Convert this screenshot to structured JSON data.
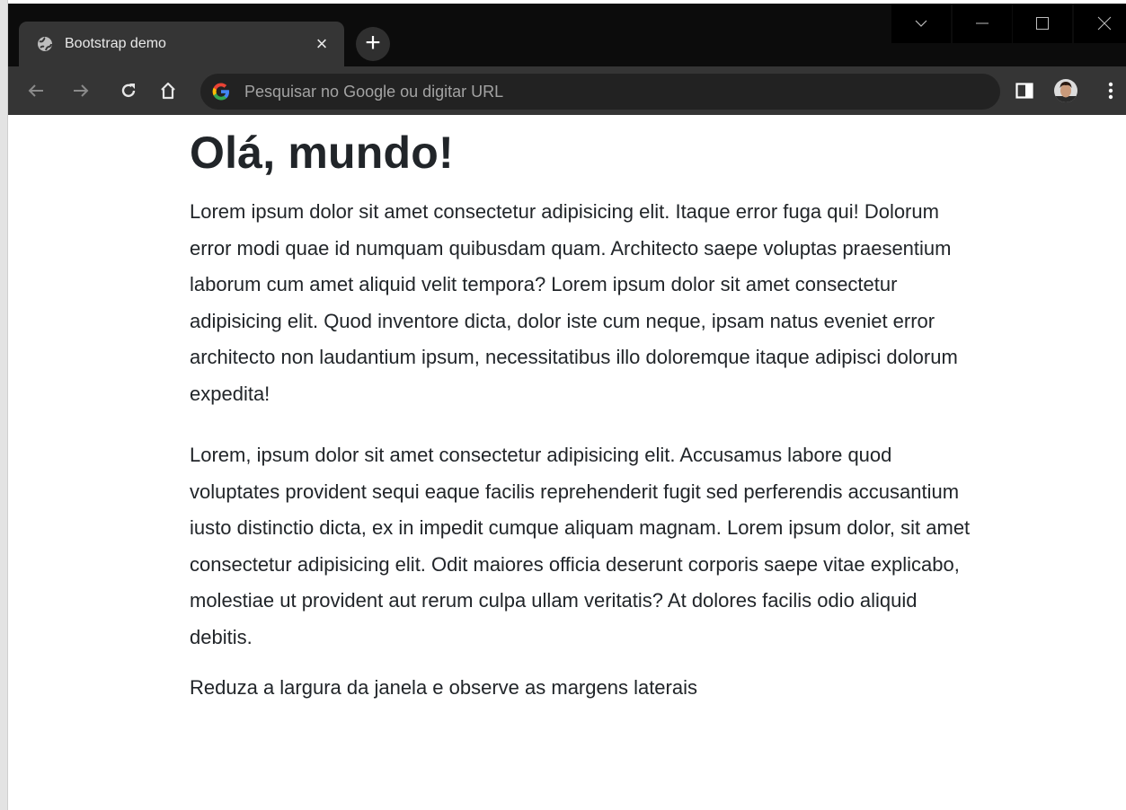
{
  "browser": {
    "tab": {
      "title": "Bootstrap demo",
      "close_glyph": "×",
      "favicon": "globe-icon"
    },
    "new_tab_glyph": "+",
    "address_bar": {
      "placeholder": "Pesquisar no Google ou digitar URL",
      "icon": "google-g-icon"
    },
    "nav": {
      "back": "arrow-left-icon",
      "forward": "arrow-right-icon",
      "reload": "reload-icon",
      "home": "home-icon"
    },
    "window_controls": [
      "tab-search-icon",
      "minimize-icon",
      "maximize-icon",
      "close-icon"
    ],
    "toolbar_right": [
      "side-panel-icon",
      "avatar",
      "kebab-menu-icon"
    ],
    "colors": {
      "tabstrip": "#0c0c0c",
      "toolbar": "#353535",
      "omnibox": "#222222",
      "text": "#212529"
    }
  },
  "page": {
    "heading": "Olá, mundo!",
    "paragraph1": "Lorem ipsum dolor sit amet consectetur adipisicing elit. Itaque error fuga qui! Dolorum error modi quae id numquam quibusdam quam. Architecto saepe voluptas praesentium laborum cum amet aliquid velit tempora? Lorem ipsum dolor sit amet consectetur adipisicing elit. Quod inventore dicta, dolor iste cum neque, ipsam natus eveniet error architecto non laudantium ipsum, necessitatibus illo doloremque itaque adipisci dolorum expedita!",
    "paragraph2": "Lorem, ipsum dolor sit amet consectetur adipisicing elit. Accusamus labore quod voluptates provident sequi eaque facilis reprehenderit fugit sed perferendis accusantium iusto distinctio dicta, ex in impedit cumque aliquam magnam. Lorem ipsum dolor, sit amet consectetur adipisicing elit. Odit maiores officia deserunt corporis saepe vitae explicabo, molestiae ut provident aut rerum culpa ullam veritatis? At dolores facilis odio aliquid debitis.",
    "paragraph3": "Reduza a largura da janela e observe as margens laterais"
  }
}
